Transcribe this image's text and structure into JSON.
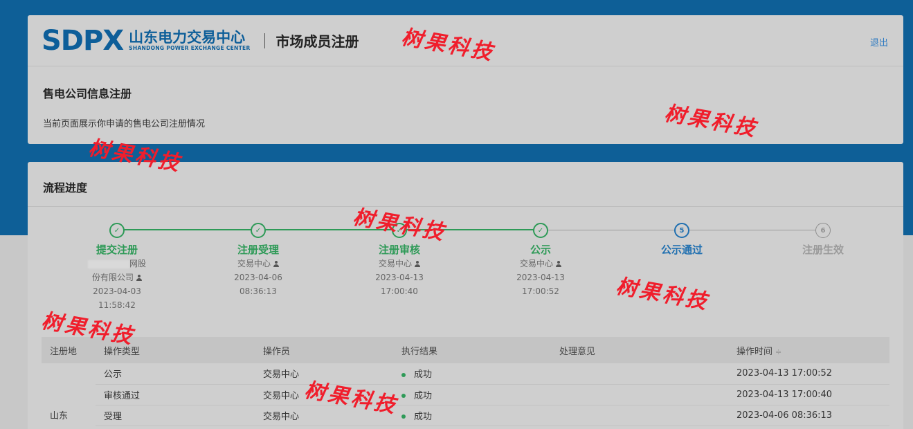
{
  "header": {
    "logo_mark": "SDPX",
    "logo_cn": "山东电力交易中心",
    "logo_en": "SHANDONG POWER EXCHANGE CENTER",
    "page_title": "市场成员注册",
    "logout": "退出"
  },
  "info": {
    "title": "售电公司信息注册",
    "description": "当前页面展示你申请的售电公司注册情况"
  },
  "process": {
    "title": "流程进度",
    "steps": [
      {
        "name": "提交注册",
        "status": "done",
        "meta1a": "",
        "meta1b": "网股",
        "meta2": "份有限公司",
        "date": "2023-04-03",
        "time": "11:58:42"
      },
      {
        "name": "注册受理",
        "status": "done",
        "operator": "交易中心",
        "date": "2023-04-06",
        "time": "08:36:13"
      },
      {
        "name": "注册审核",
        "status": "done",
        "operator": "交易中心",
        "date": "2023-04-13",
        "time": "17:00:40"
      },
      {
        "name": "公示",
        "status": "done",
        "operator": "交易中心",
        "date": "2023-04-13",
        "time": "17:00:52"
      },
      {
        "name": "公示通过",
        "status": "current",
        "number": "5"
      },
      {
        "name": "注册生效",
        "status": "pending",
        "number": "6"
      }
    ]
  },
  "table": {
    "headers": [
      "注册地",
      "操作类型",
      "操作员",
      "执行结果",
      "处理意见",
      "操作时间"
    ],
    "sort_icon": "≑",
    "region": "山东",
    "rows": [
      {
        "type": "公示",
        "operator": "交易中心",
        "result": "成功",
        "opinion": "",
        "time": "2023-04-13 17:00:52"
      },
      {
        "type": "审核通过",
        "operator": "交易中心",
        "result": "成功",
        "opinion": "",
        "time": "2023-04-13 17:00:40"
      },
      {
        "type": "受理",
        "operator": "交易中心",
        "result": "成功",
        "opinion": "",
        "time": "2023-04-06 08:36:13"
      }
    ]
  },
  "watermark": "树果科技",
  "colors": {
    "brand_blue": "#0d5e99",
    "done_green": "#2e9a57",
    "current_blue": "#1f6fb0",
    "watermark_red": "#f01e2c"
  }
}
